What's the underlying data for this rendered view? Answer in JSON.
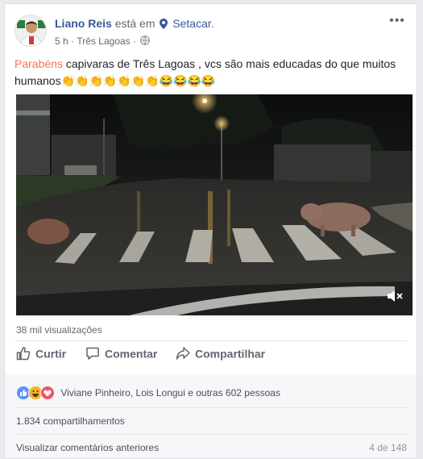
{
  "post": {
    "author": "Liano Reis",
    "at_text": "está em",
    "place": "Setacar.",
    "time": "5 h",
    "separator": "·",
    "location": "Três Lagoas",
    "separator2": "·",
    "text_highlight": "Parabéns",
    "text_rest": " capivaras de Três Lagoas , vcs são mais educadas do que muitos humanos",
    "emojis": "👏👏👏👏👏👏👏😂😂😂😂"
  },
  "video": {
    "views": "38 mil visualizações"
  },
  "actions": {
    "like": "Curtir",
    "comment": "Comentar",
    "share": "Compartilhar"
  },
  "reactions": {
    "text": "Viviane Pinheiro, Lois Longui e outras 602 pessoas",
    "types": [
      "like-icon",
      "haha-icon",
      "love-icon"
    ]
  },
  "shares": "1.834 compartilhamentos",
  "comments": {
    "view_previous": "Visualizar comentários anteriores",
    "count": "4 de 148"
  },
  "colors": {
    "link": "#365899",
    "highlight": "#f6764d",
    "like": "#5890ff",
    "haha": "#f7b125",
    "love": "#f25268"
  }
}
